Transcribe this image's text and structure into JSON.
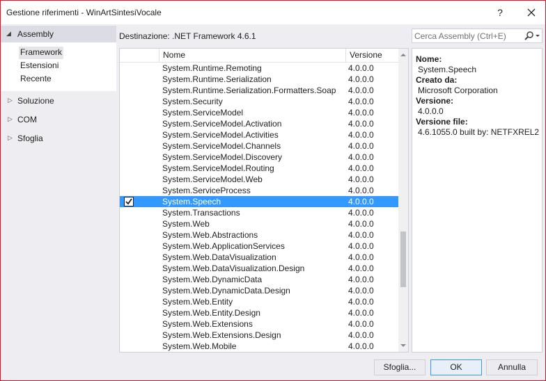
{
  "window": {
    "title": "Gestione riferimenti - WinArtSintesiVocale",
    "help_label": "?"
  },
  "nav": {
    "header": "Assembly",
    "subitems": [
      "Framework",
      "Estensioni",
      "Recente"
    ],
    "groups": [
      "Soluzione",
      "COM",
      "Sfoglia"
    ]
  },
  "target_label": "Destinazione: .NET Framework 4.6.1",
  "search": {
    "placeholder": "Cerca Assembly (Ctrl+E)",
    "value": ""
  },
  "list": {
    "columns": {
      "name": "Nome",
      "version": "Versione"
    },
    "rows": [
      {
        "name": "System.Runtime.Remoting",
        "version": "4.0.0.0",
        "checked": false,
        "selected": false
      },
      {
        "name": "System.Runtime.Serialization",
        "version": "4.0.0.0",
        "checked": false,
        "selected": false
      },
      {
        "name": "System.Runtime.Serialization.Formatters.Soap",
        "version": "4.0.0.0",
        "checked": false,
        "selected": false
      },
      {
        "name": "System.Security",
        "version": "4.0.0.0",
        "checked": false,
        "selected": false
      },
      {
        "name": "System.ServiceModel",
        "version": "4.0.0.0",
        "checked": false,
        "selected": false
      },
      {
        "name": "System.ServiceModel.Activation",
        "version": "4.0.0.0",
        "checked": false,
        "selected": false
      },
      {
        "name": "System.ServiceModel.Activities",
        "version": "4.0.0.0",
        "checked": false,
        "selected": false
      },
      {
        "name": "System.ServiceModel.Channels",
        "version": "4.0.0.0",
        "checked": false,
        "selected": false
      },
      {
        "name": "System.ServiceModel.Discovery",
        "version": "4.0.0.0",
        "checked": false,
        "selected": false
      },
      {
        "name": "System.ServiceModel.Routing",
        "version": "4.0.0.0",
        "checked": false,
        "selected": false
      },
      {
        "name": "System.ServiceModel.Web",
        "version": "4.0.0.0",
        "checked": false,
        "selected": false
      },
      {
        "name": "System.ServiceProcess",
        "version": "4.0.0.0",
        "checked": false,
        "selected": false
      },
      {
        "name": "System.Speech",
        "version": "4.0.0.0",
        "checked": true,
        "selected": true
      },
      {
        "name": "System.Transactions",
        "version": "4.0.0.0",
        "checked": false,
        "selected": false
      },
      {
        "name": "System.Web",
        "version": "4.0.0.0",
        "checked": false,
        "selected": false
      },
      {
        "name": "System.Web.Abstractions",
        "version": "4.0.0.0",
        "checked": false,
        "selected": false
      },
      {
        "name": "System.Web.ApplicationServices",
        "version": "4.0.0.0",
        "checked": false,
        "selected": false
      },
      {
        "name": "System.Web.DataVisualization",
        "version": "4.0.0.0",
        "checked": false,
        "selected": false
      },
      {
        "name": "System.Web.DataVisualization.Design",
        "version": "4.0.0.0",
        "checked": false,
        "selected": false
      },
      {
        "name": "System.Web.DynamicData",
        "version": "4.0.0.0",
        "checked": false,
        "selected": false
      },
      {
        "name": "System.Web.DynamicData.Design",
        "version": "4.0.0.0",
        "checked": false,
        "selected": false
      },
      {
        "name": "System.Web.Entity",
        "version": "4.0.0.0",
        "checked": false,
        "selected": false
      },
      {
        "name": "System.Web.Entity.Design",
        "version": "4.0.0.0",
        "checked": false,
        "selected": false
      },
      {
        "name": "System.Web.Extensions",
        "version": "4.0.0.0",
        "checked": false,
        "selected": false
      },
      {
        "name": "System.Web.Extensions.Design",
        "version": "4.0.0.0",
        "checked": false,
        "selected": false
      },
      {
        "name": "System.Web.Mobile",
        "version": "4.0.0.0",
        "checked": false,
        "selected": false
      }
    ]
  },
  "details": {
    "name_label": "Nome:",
    "name_value": "System.Speech",
    "creator_label": "Creato da:",
    "creator_value": "Microsoft Corporation",
    "version_label": "Versione:",
    "version_value": "4.0.0.0",
    "file_version_label": "Versione file:",
    "file_version_value": "4.6.1055.0 built by: NETFXREL2"
  },
  "buttons": {
    "browse": "Sfoglia...",
    "ok": "OK",
    "cancel": "Annulla"
  },
  "colors": {
    "selection": "#3399ff",
    "window_border": "#e81123",
    "chrome": "#eeeef2"
  }
}
